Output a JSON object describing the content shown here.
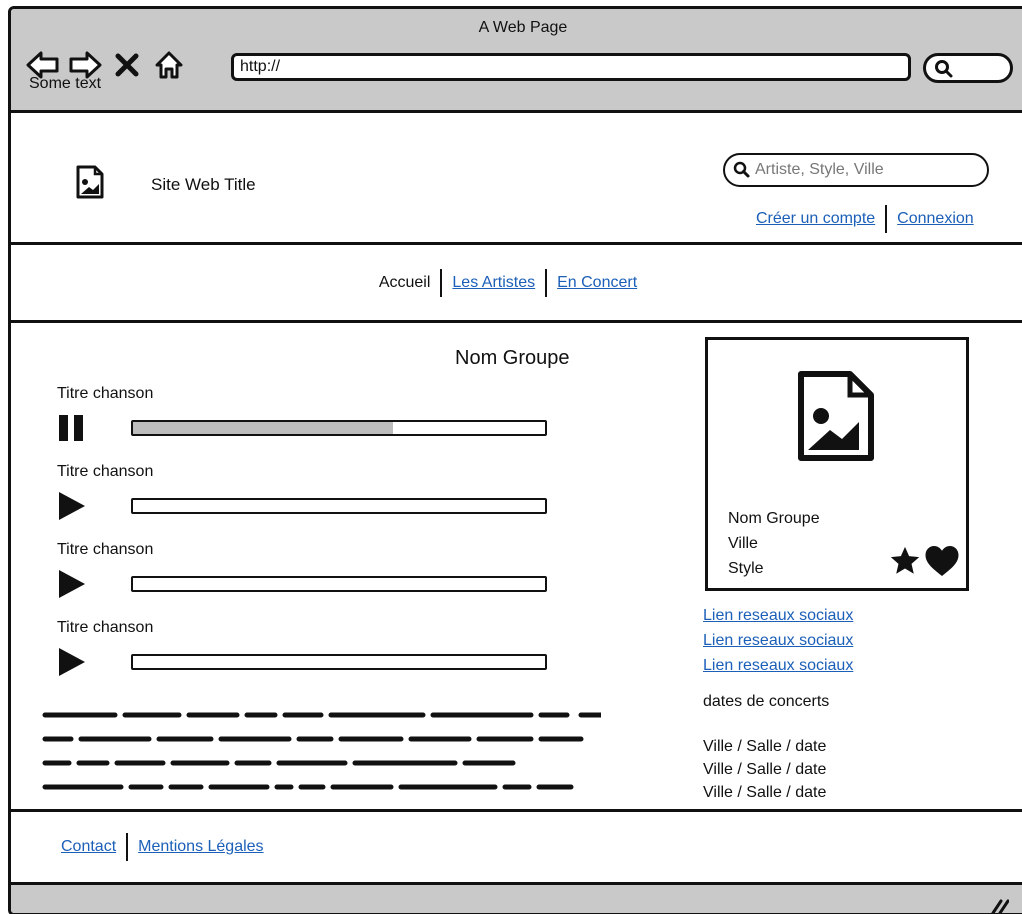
{
  "window": {
    "title": "A Web Page",
    "caption": "Some text",
    "url": "http://"
  },
  "header": {
    "site_title": "Site Web Title",
    "search_placeholder": "Artiste, Style, Ville",
    "create_account": "Créer un compte",
    "login": "Connexion"
  },
  "nav": {
    "home": "Accueil",
    "artists": "Les Artistes",
    "concerts": "En Concert"
  },
  "main": {
    "band_name": "Nom Groupe",
    "tracks": [
      {
        "title": "Titre chanson",
        "state": "pause-icon",
        "progress": 0.63
      },
      {
        "title": "Titre chanson",
        "state": "play-icon",
        "progress": 0
      },
      {
        "title": "Titre chanson",
        "state": "play-icon",
        "progress": 0
      },
      {
        "title": "Titre chanson",
        "state": "play-icon",
        "progress": 0
      }
    ]
  },
  "card": {
    "name": "Nom Groupe",
    "city": "Ville",
    "style": "Style"
  },
  "sidebar": {
    "social_links": [
      "Lien reseaux sociaux",
      "Lien reseaux sociaux",
      "Lien reseaux sociaux"
    ],
    "dates_title": "dates de concerts",
    "dates": [
      "Ville / Salle / date",
      "Ville / Salle / date",
      "Ville / Salle / date"
    ]
  },
  "footer": {
    "contact": "Contact",
    "legal": "Mentions Légales"
  },
  "colors": {
    "chrome": "#c9c9c9",
    "link": "#1c5fb8",
    "progress_fill": "#bdbdbd"
  }
}
